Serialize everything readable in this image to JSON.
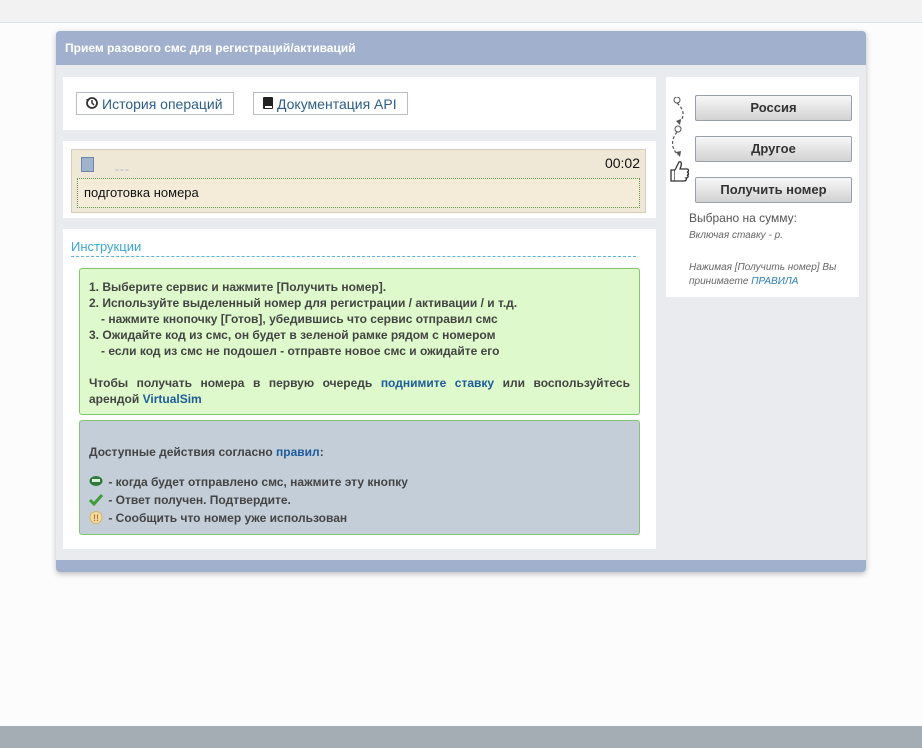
{
  "panel": {
    "title": "Прием разового смс для регистраций/активаций"
  },
  "toolbar": {
    "history_label": "История операций",
    "api_docs_label": "Документация API"
  },
  "sms": {
    "number_placeholder": "---",
    "timer": "00:02",
    "status": "подготовка номера"
  },
  "instructions": {
    "title": "Инструкции",
    "steps": [
      {
        "num": "1.",
        "text": "Выберите сервис и нажмите [Получить номер]."
      },
      {
        "num": "2.",
        "text": "Используйте выделенный номер для регистрации / активации / и т.д."
      },
      {
        "num": "",
        "text": "- нажмите кнопочку [Готов], убедившись что сервис отправил смс"
      },
      {
        "num": "3.",
        "text": "Ожидайте код из смс, он будет в зеленой рамке рядом с номером"
      },
      {
        "num": "",
        "text": "- если код из смс не подошел - отправте новое смс и ожидайте его"
      }
    ],
    "priority_before": "Чтобы получать номера в первую очередь ",
    "priority_link": "поднимите ставку",
    "priority_middle": " или воспользуйтесь арендой ",
    "virtualsim_link": "VirtualSim"
  },
  "actions": {
    "title_before": "Доступные действия согласно ",
    "rules_link": "правил",
    "title_after": ":",
    "items": [
      {
        "icon": "sms-sent-icon",
        "text": " - когда будет отправлено смс, нажмите эту кнопку"
      },
      {
        "icon": "checkmark-icon",
        "text": " - Ответ получен. Подтвердите."
      },
      {
        "icon": "used-number-icon",
        "text": " - Сообщить что номер уже использован"
      }
    ]
  },
  "order": {
    "country_button": "Россия",
    "service_button": "Другое",
    "get_number_button": "Получить номер",
    "sum_label": "Выбрано на сумму:",
    "rate_label": "Включая ставку - р.",
    "agreement_text": "Нажимая [Получить номер] Вы принимаете ",
    "rules_link": "ПРАВИЛА"
  },
  "colors": {
    "header_bar": "#a1b0cc",
    "link": "#2c5e8a",
    "green_box": "#def9cb",
    "gray_box": "#c3ced8",
    "sms_box": "#f0e8d7"
  }
}
